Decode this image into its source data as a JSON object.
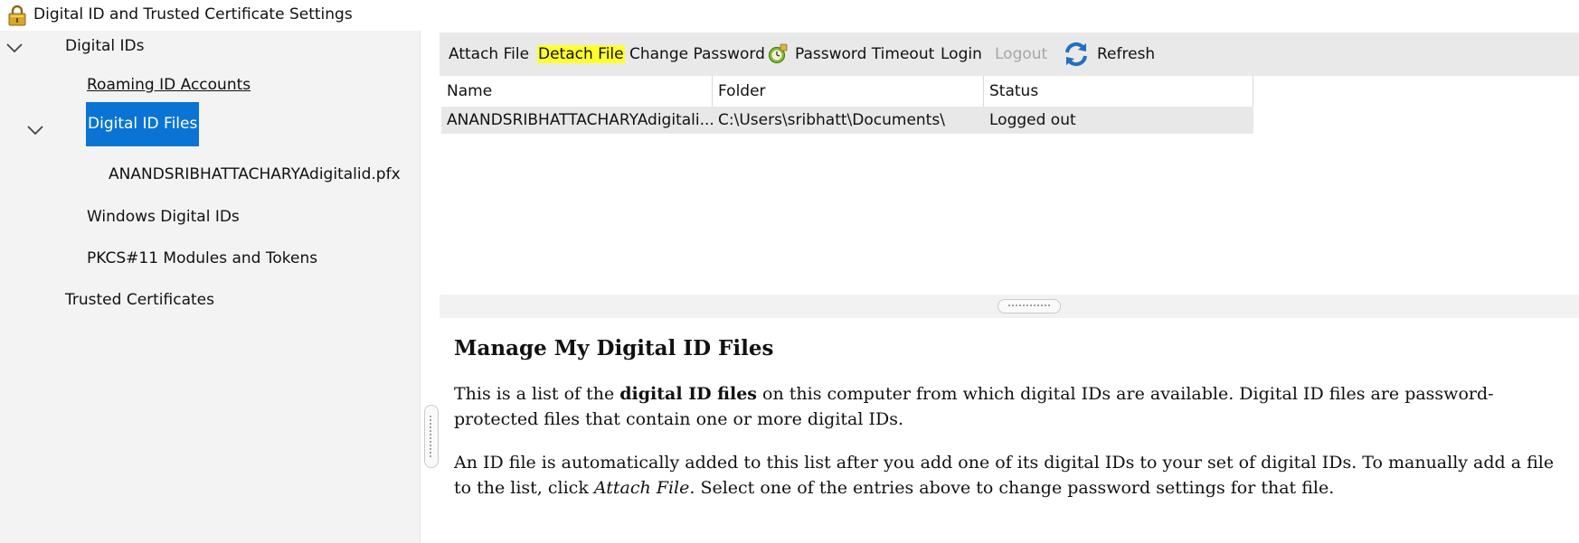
{
  "window": {
    "title": "Digital ID and Trusted Certificate Settings"
  },
  "tree": {
    "digital_ids": "Digital IDs",
    "roaming": "Roaming ID Accounts",
    "digital_id_files": "Digital ID Files",
    "pfx_file": "ANANDSRIBHATTACHARYAdigitalid.pfx",
    "windows_ids": "Windows Digital IDs",
    "pkcs": "PKCS#11 Modules and Tokens",
    "trusted": "Trusted Certificates"
  },
  "toolbar": {
    "attach": "Attach File",
    "detach": "Detach File",
    "change_password": "Change Password",
    "password_timeout": "Password Timeout",
    "login": "Login",
    "logout": "Logout",
    "refresh": "Refresh"
  },
  "table": {
    "headers": {
      "name": "Name",
      "folder": "Folder",
      "status": "Status"
    },
    "rows": [
      {
        "name": "ANANDSRIBHATTACHARYAdigitali...",
        "folder": "C:\\Users\\sribhatt\\Documents\\",
        "status": "Logged out"
      }
    ]
  },
  "help": {
    "heading": "Manage My Digital ID Files",
    "p1_pre": "This is a list of the ",
    "p1_bold": "digital ID files",
    "p1_post": " on this computer from which digital IDs are available. Digital ID files are password-protected files that contain one or more digital IDs.",
    "p2_pre": "An ID file is automatically added to this list after you add one of its digital IDs to your set of digital IDs. To manually add a file to the list, click ",
    "p2_em": "Attach File",
    "p2_post": ". Select one of the entries above to change password settings for that file."
  },
  "colors": {
    "selection": "#0a74d4",
    "highlight": "#ffff2e",
    "disabled": "#a6a6a6"
  }
}
